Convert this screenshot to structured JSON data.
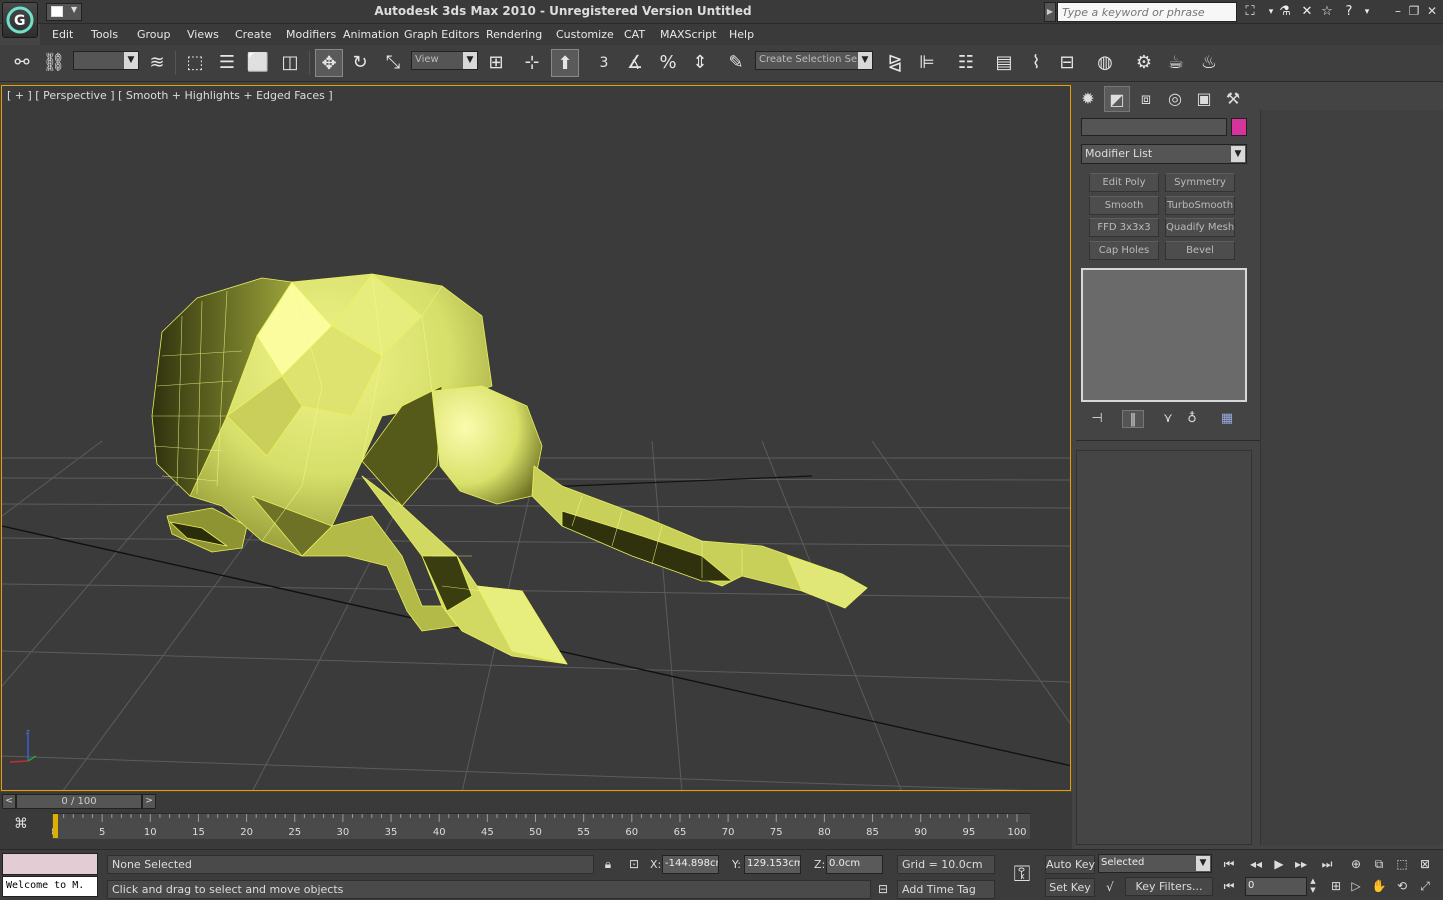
{
  "window": {
    "title": "Autodesk 3ds Max  2010  - Unregistered Version     Untitled"
  },
  "search": {
    "placeholder": "Type a keyword or phrase"
  },
  "menu": [
    "Edit",
    "Tools",
    "Group",
    "Views",
    "Create",
    "Modifiers",
    "Animation",
    "Graph Editors",
    "Rendering",
    "Customize",
    "CAT",
    "MAXScript",
    "Help"
  ],
  "toolbar": {
    "selection_filter": "",
    "ref_coord": "View",
    "snap_value": "3",
    "named_selection": "Create Selection Se"
  },
  "viewport": {
    "label": "[ + ] [ Perspective ] [ Smooth + Highlights + Edged Faces ]",
    "axis_z": "z"
  },
  "command_panel": {
    "object_name": "",
    "object_color": "#d6339c",
    "modifier_list": "Modifier List",
    "modifier_buttons": [
      "Edit Poly",
      "Symmetry",
      "Smooth",
      "TurboSmooth",
      "FFD 3x3x3",
      "Quadify Mesh",
      "Cap Holes",
      "Bevel"
    ]
  },
  "time_slider": {
    "position": "0 / 100",
    "prev": "<",
    "next": ">"
  },
  "timeline": {
    "ticks": [
      "0",
      "5",
      "10",
      "15",
      "20",
      "25",
      "30",
      "35",
      "40",
      "45",
      "50",
      "55",
      "60",
      "65",
      "70",
      "75",
      "80",
      "85",
      "90",
      "95",
      "100"
    ]
  },
  "status": {
    "maxscript_listener": "Welcome to M.",
    "selection": "None Selected",
    "prompt": "Click and drag to select and move objects",
    "x_label": "X:",
    "x": "-144.898cm",
    "y_label": "Y:",
    "y": "129.153cm",
    "z_label": "Z:",
    "z": "0.0cm",
    "grid": "Grid = 10.0cm",
    "add_time_tag": "Add Time Tag",
    "auto_key": "Auto Key",
    "set_key": "Set Key",
    "key_mode": "Selected",
    "key_filters": "Key Filters...",
    "frame": "0"
  },
  "colors": {
    "viewport_border": "#e8a000",
    "mesh": "#d6df6a",
    "mesh_shadow": "#3a3c12"
  }
}
